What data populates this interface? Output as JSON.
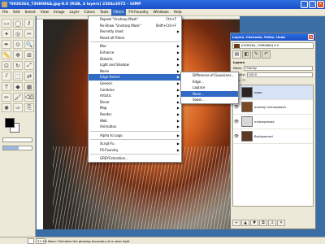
{
  "window": {
    "title": "*0038264_7308086A.jpg-8.0 (RGB, 4 layers) 2304x3072 – GIMP",
    "buttons": {
      "minimize": "_",
      "maximize": "□",
      "close": "×"
    }
  },
  "menubar": [
    "File",
    "Edit",
    "Select",
    "View",
    "Image",
    "Layer",
    "Colors",
    "Tools",
    "Filters",
    "FX-Foundry",
    "Windows",
    "Help"
  ],
  "filters_menu": {
    "items": [
      {
        "label": "Repeat \"Unsharp Mask\"",
        "accel": "Ctrl+F"
      },
      {
        "label": "Re-Show \"Unsharp Mask\"",
        "accel": "Shift+Ctrl+F"
      },
      {
        "label": "Recently Used",
        "arrow": true
      },
      {
        "label": "Reset all Filters"
      },
      {
        "sep": true
      },
      {
        "label": "Blur",
        "arrow": true
      },
      {
        "label": "Enhance",
        "arrow": true
      },
      {
        "label": "Distorts",
        "arrow": true
      },
      {
        "label": "Light and Shadow",
        "arrow": true
      },
      {
        "label": "Noise",
        "arrow": true
      },
      {
        "label": "Edge-Detect",
        "arrow": true,
        "highlight": true
      },
      {
        "label": "Generic",
        "arrow": true
      },
      {
        "label": "Combine",
        "arrow": true
      },
      {
        "label": "Artistic",
        "arrow": true
      },
      {
        "label": "Decor",
        "arrow": true
      },
      {
        "label": "Map",
        "arrow": true
      },
      {
        "label": "Render",
        "arrow": true
      },
      {
        "label": "Web",
        "arrow": true
      },
      {
        "label": "Animation",
        "arrow": true
      },
      {
        "sep": true
      },
      {
        "label": "Alpha to Logo",
        "arrow": true
      },
      {
        "sep": true
      },
      {
        "label": "Script-Fu",
        "arrow": true
      },
      {
        "label": "FX-Foundry",
        "arrow": true
      },
      {
        "sep": true
      },
      {
        "label": "GREYCstoration..."
      }
    ]
  },
  "edge_menu": {
    "items": [
      {
        "label": "Difference of Gaussians..."
      },
      {
        "label": "Edge..."
      },
      {
        "label": "Laplace"
      },
      {
        "label": "Neon...",
        "highlight": true
      },
      {
        "label": "Sobel..."
      }
    ]
  },
  "dock": {
    "title": "Layers, Channels, Paths, Undo",
    "image_selector": "[0038264_7308086A] 9.0",
    "auto_button": "Auto",
    "section_label": "Layers",
    "mode_label": "Mode:",
    "mode_value": "Overlay",
    "opacity_label": "Opacity:",
    "opacity_value": "100.0",
    "lock_label": "Lock:",
    "layers": [
      {
        "name": "neon",
        "thumb": "#2a2422",
        "selected": true
      },
      {
        "name": "overlay mcharpeach",
        "thumb": "#7a4a24",
        "selected": false
      },
      {
        "name": "mcharpmask",
        "thumb": "#d8d8d8",
        "selected": false
      },
      {
        "name": "Background",
        "thumb": "#5a3a24",
        "selected": false
      }
    ],
    "button_icons": [
      "new-layer",
      "raise",
      "lower",
      "duplicate",
      "anchor",
      "delete"
    ]
  },
  "statusbar": {
    "zoom": "33.3%",
    "message": "Neon: Simulate the glowing boundary of a neon light"
  },
  "toolbox": {
    "tools": [
      "rect-select",
      "ellipse-select",
      "free-select",
      "fuzzy-select",
      "color-select",
      "scissors",
      "paths",
      "color-picker",
      "zoom",
      "measure",
      "move",
      "align",
      "crop",
      "rotate",
      "scale",
      "shear",
      "perspective",
      "flip",
      "text",
      "bucket-fill",
      "blend",
      "pencil",
      "paintbrush",
      "eraser",
      "airbrush",
      "ink",
      "clone",
      "heal",
      "perspective-clone",
      "blur",
      "smudge",
      "dodge-burn"
    ],
    "fg_color": "#000000",
    "bg_color": "#ffffff",
    "slider_values": [
      0.0,
      0.55
    ]
  }
}
